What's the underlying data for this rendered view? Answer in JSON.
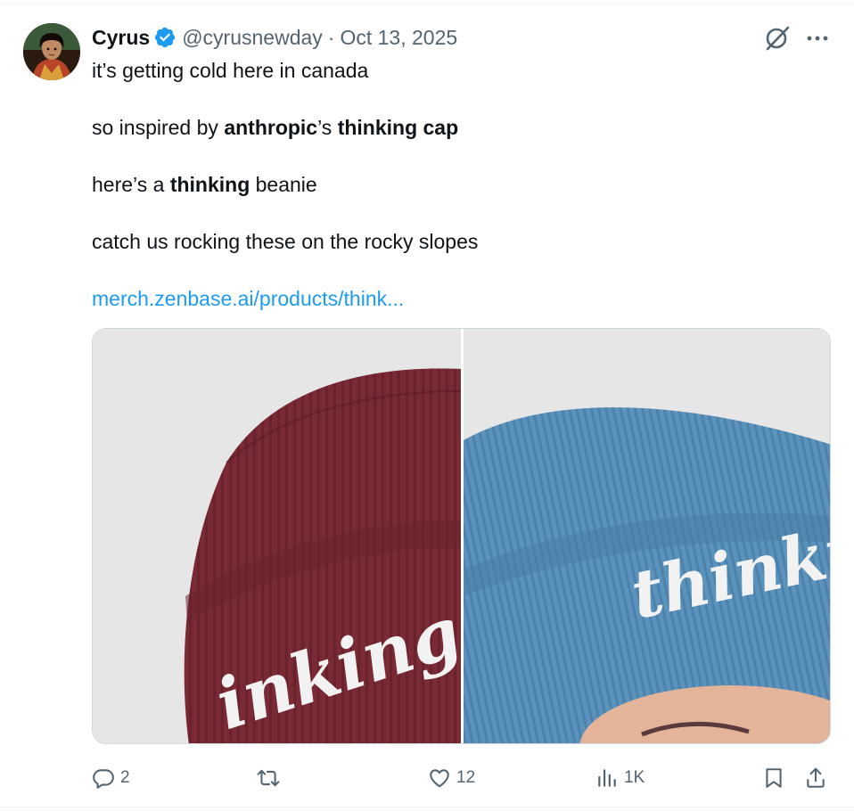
{
  "tweet": {
    "author": {
      "display_name": "Cyrus",
      "handle": "@cyrusnewday",
      "verified": true,
      "avatar_icon": "profile-avatar"
    },
    "separator": "·",
    "date": "Oct 13, 2025",
    "lines": {
      "line1": "it’s getting cold here in canada",
      "line2_a": "so inspired by ",
      "line2_b": "anthropic",
      "line2_c": "’s ",
      "line2_d": "thinking cap",
      "line3_a": "here’s a ",
      "line3_b": "thinking",
      "line3_c": " beanie",
      "line4": "catch us rocking these on the rocky slopes"
    },
    "link_text": "merch.zenbase.ai/products/think...",
    "media": {
      "left_image_text": "inking",
      "right_image_text": "thinki",
      "left_color": "#7a2a34",
      "right_color": "#5b93bd"
    },
    "actions": {
      "replies": "2",
      "retweets": "",
      "likes": "12",
      "views": "1K"
    },
    "colors": {
      "link": "#1d9bf0",
      "verified": "#1d9bf0",
      "secondary_text": "#536471"
    }
  }
}
